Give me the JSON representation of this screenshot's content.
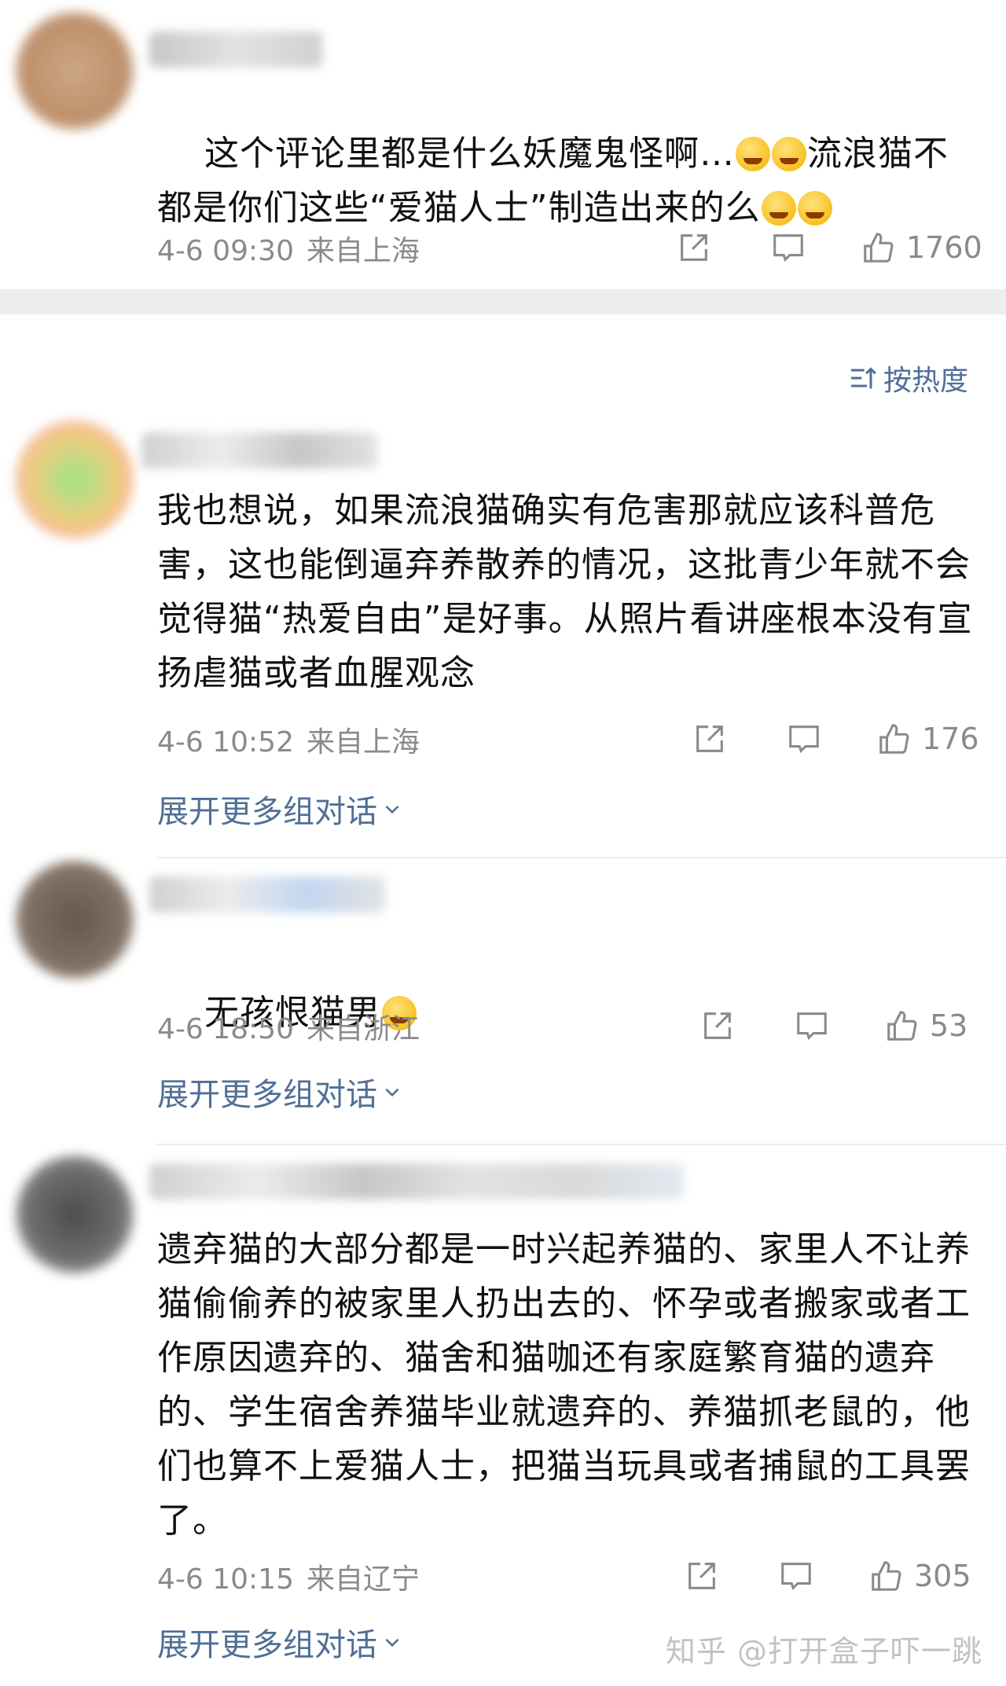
{
  "sort_label": "按热度",
  "expand_label": "展开更多组对话",
  "watermark": "知乎 @打开盒子吓一跳",
  "comments": [
    {
      "text_1": "这个评论里都是什么妖魔鬼怪啊…",
      "text_2": "流浪猫不",
      "text_3": "都是你们这些“爱猫人士”制造出来的么",
      "time": "4-6 09:30",
      "location": "来自上海",
      "likes": "1760"
    },
    {
      "text": "我也想说，如果流浪猫确实有危害那就应该科普危害，这也能倒逼弃养散养的情况，这批青少年就不会觉得猫“热爱自由”是好事。从照片看讲座根本没有宣扬虐猫或者血腥观念",
      "time": "4-6 10:52",
      "location": "来自上海",
      "likes": "176"
    },
    {
      "text": "无孩恨猫男",
      "time": "4-6 18:50",
      "location": "来自浙江",
      "likes": "53"
    },
    {
      "text": "遗弃猫的大部分都是一时兴起养猫的、家里人不让养猫偷偷养的被家里人扔出去的、怀孕或者搬家或者工作原因遗弃的、猫舍和猫咖还有家庭繁育猫的遗弃的、学生宿舍养猫毕业就遗弃的、养猫抓老鼠的，他们也算不上爱猫人士，把猫当玩具或者捕鼠的工具罢了。",
      "time": "4-6 10:15",
      "location": "来自辽宁",
      "likes": "305"
    }
  ],
  "icons": {
    "share": "share-icon",
    "comment": "comment-icon",
    "like": "thumbs-up-icon",
    "sort": "sort-icon",
    "chevron": "chevron-down-icon",
    "emoji": "laughing-crying-emoji"
  },
  "colors": {
    "link": "#4f6f96",
    "meta": "#8a8a8a",
    "band": "#eeeeee"
  }
}
